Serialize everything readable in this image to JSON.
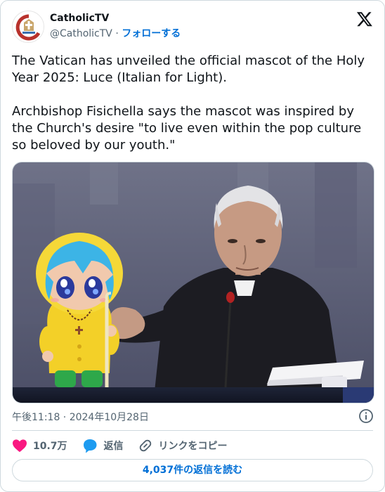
{
  "author": {
    "display_name": "CatholicTV",
    "handle": "@CatholicTV",
    "separator": "·",
    "follow_label": "フォローする"
  },
  "tweet": {
    "paragraph1": "The Vatican has unveiled the official mascot of the Holy Year 2025: Luce (Italian for Light).",
    "paragraph2": "Archbishop Fisichella says the mascot was inspired by the Church's desire \"to live even within the pop culture so beloved by our youth.\"",
    "timestamp": "午後11:18 · 2024年10月28日"
  },
  "actions": {
    "likes_count": "10.7万",
    "reply_label": "返信",
    "copy_link_label": "リンクをコピー"
  },
  "read_replies_label": "4,037件の返信を読む",
  "colors": {
    "like": "#f91880",
    "reply": "#1d9bf0",
    "link": "#006fd6",
    "muted": "#536471",
    "border": "#cfd9de"
  },
  "icons": [
    "x-logo-icon",
    "info-icon",
    "heart-icon",
    "reply-bubble-icon",
    "link-icon"
  ]
}
